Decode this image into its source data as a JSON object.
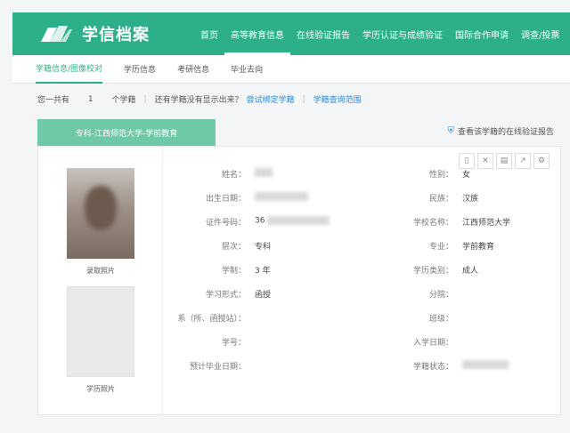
{
  "header": {
    "logo_text": "学信档案",
    "nav": [
      "首页",
      "高等教育信息",
      "在线验证报告",
      "学历认证与成绩验证",
      "国际合作申请",
      "调查/投票"
    ]
  },
  "subnav": [
    "学籍信息/图像校对",
    "学历信息",
    "考研信息",
    "毕业去向"
  ],
  "infobar": {
    "count_text": "您一共有",
    "count_value": "1",
    "count_unit": "个学籍",
    "question": "还有学籍没有显示出来？",
    "try_text": "尝试绑定学籍",
    "scope_link": "学籍查询范围"
  },
  "tab_label": "专科-江西师范大学-学前教育",
  "verify_link": "查看该学籍的在线验证报告",
  "tools": [
    "mobile-icon",
    "expand-icon",
    "print-icon",
    "export-icon",
    "settings-icon"
  ],
  "photos": {
    "photo1_label": "录取照片",
    "photo2_label": "学历照片"
  },
  "fields": [
    {
      "left_label": "姓名：",
      "left_value": "",
      "right_label": "性别：",
      "right_value": "女"
    },
    {
      "left_label": "出生日期：",
      "left_value": "",
      "right_label": "民族：",
      "right_value": "汉族"
    },
    {
      "left_label": "证件号码：",
      "left_value": "36",
      "right_label": "学校名称：",
      "right_value": "江西师范大学"
    },
    {
      "left_label": "层次：",
      "left_value": "专科",
      "right_label": "专业：",
      "right_value": "学前教育"
    },
    {
      "left_label": "学制：",
      "left_value": "3 年",
      "right_label": "学历类别：",
      "right_value": "成人"
    },
    {
      "left_label": "学习形式：",
      "left_value": "函授",
      "right_label": "分院：",
      "right_value": ""
    },
    {
      "left_label": "系（所、函授站）：",
      "left_value": "",
      "right_label": "班级：",
      "right_value": ""
    },
    {
      "left_label": "学号：",
      "left_value": "",
      "right_label": "入学日期：",
      "right_value": ""
    },
    {
      "left_label": "预计毕业日期：",
      "left_value": "",
      "right_label": "学籍状态：",
      "right_value": ""
    }
  ]
}
